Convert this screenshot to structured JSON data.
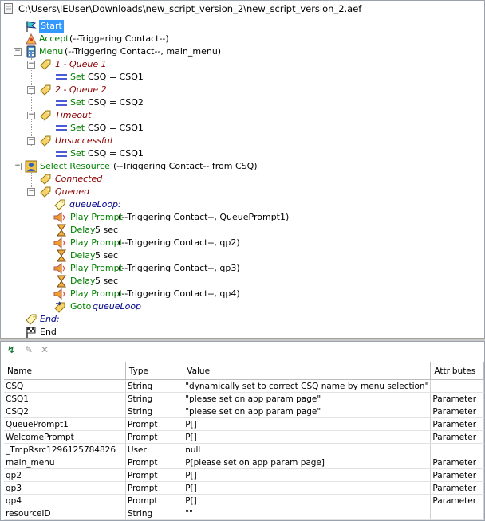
{
  "window": {
    "title": "C:\\Users\\IEUser\\Downloads\\new_script_version_2\\new_script_version_2.aef"
  },
  "tree": {
    "start": "Start",
    "accept_kw": "Accept",
    "accept_args": "(--Triggering Contact--)",
    "menu_kw": "Menu",
    "menu_args": "(--Triggering Contact--, main_menu)",
    "q1": "1 - Queue 1",
    "set1_kw": "Set",
    "set1_args": "CSQ = CSQ1",
    "q2": "2 - Queue 2",
    "set2_kw": "Set",
    "set2_args": "CSQ = CSQ2",
    "timeout": "Timeout",
    "set3_kw": "Set",
    "set3_args": "CSQ = CSQ1",
    "unsuccessful": "Unsuccessful",
    "set4_kw": "Set",
    "set4_args": "CSQ = CSQ1",
    "select_kw": "Select Resource",
    "select_args": "(--Triggering Contact-- from CSQ)",
    "connected": "Connected",
    "queued": "Queued",
    "queueloop": "queueLoop:",
    "pp1_kw": "Play Prompt",
    "pp1_args": "(--Triggering Contact--, QueuePrompt1)",
    "d1_kw": "Delay",
    "d1_args": "5 sec",
    "pp2_kw": "Play Prompt",
    "pp2_args": "(--Triggering Contact--, qp2)",
    "d2_kw": "Delay",
    "d2_args": "5 sec",
    "pp3_kw": "Play Prompt",
    "pp3_args": "(--Triggering Contact--, qp3)",
    "d3_kw": "Delay",
    "d3_args": "5 sec",
    "pp4_kw": "Play Prompt",
    "pp4_args": "(--Triggering Contact--, qp4)",
    "goto_kw": "Goto",
    "goto_args": "queueLoop",
    "end_label": "End:",
    "end": "End"
  },
  "variables": {
    "headers": {
      "name": "Name",
      "type": "Type",
      "value": "Value",
      "attributes": "Attributes"
    },
    "rows": [
      {
        "name": "CSQ",
        "type": "String",
        "value": "\"dynamically set to correct CSQ name by menu selection\"",
        "attributes": ""
      },
      {
        "name": "CSQ1",
        "type": "String",
        "value": "\"please set on app param page\"",
        "attributes": "Parameter"
      },
      {
        "name": "CSQ2",
        "type": "String",
        "value": "\"please set on app param page\"",
        "attributes": "Parameter"
      },
      {
        "name": "QueuePrompt1",
        "type": "Prompt",
        "value": "P[]",
        "attributes": "Parameter"
      },
      {
        "name": "WelcomePrompt",
        "type": "Prompt",
        "value": "P[]",
        "attributes": "Parameter"
      },
      {
        "name": "_TmpRsrc1296125784826",
        "type": "User",
        "value": "null",
        "attributes": ""
      },
      {
        "name": "main_menu",
        "type": "Prompt",
        "value": "P[please set on app param page]",
        "attributes": "Parameter"
      },
      {
        "name": "qp2",
        "type": "Prompt",
        "value": "P[]",
        "attributes": "Parameter"
      },
      {
        "name": "qp3",
        "type": "Prompt",
        "value": "P[]",
        "attributes": "Parameter"
      },
      {
        "name": "qp4",
        "type": "Prompt",
        "value": "P[]",
        "attributes": "Parameter"
      },
      {
        "name": "resourceID",
        "type": "String",
        "value": "\"\"",
        "attributes": ""
      }
    ]
  },
  "colors": {
    "step": "#007f00",
    "branch": "#8b0000",
    "label": "#00008b",
    "selection": "#3399ff"
  }
}
